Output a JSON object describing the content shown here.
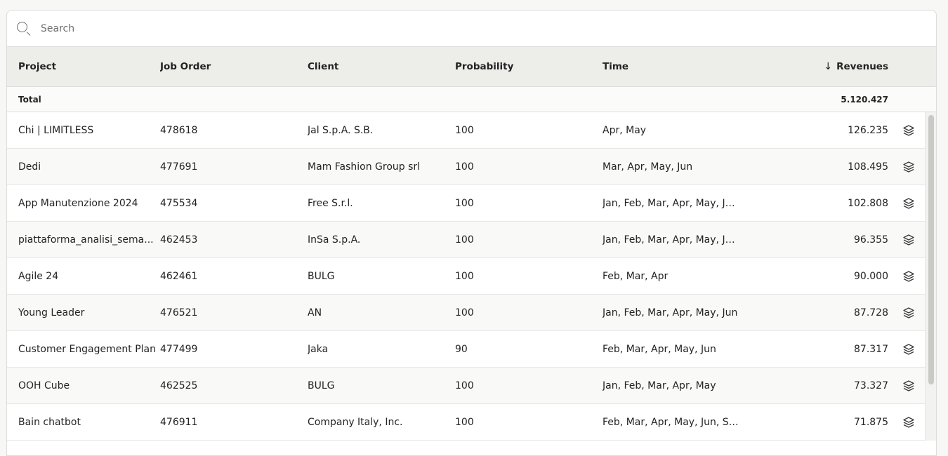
{
  "search": {
    "placeholder": "Search",
    "value": ""
  },
  "columns": {
    "project": "Project",
    "job_order": "Job Order",
    "client": "Client",
    "probability": "Probability",
    "time": "Time",
    "revenues": "Revenues",
    "sort_indicator": "↓"
  },
  "total": {
    "label": "Total",
    "revenues": "5.120.427"
  },
  "rows": [
    {
      "project": "Chi | LIMITLESS",
      "job_order": "478618",
      "client": "Jal S.p.A. S.B.",
      "probability": "100",
      "time": "Apr, May",
      "revenues": "126.235"
    },
    {
      "project": "Dedi",
      "job_order": "477691",
      "client": "Mam Fashion Group srl",
      "probability": "100",
      "time": "Mar, Apr, May, Jun",
      "revenues": "108.495"
    },
    {
      "project": "App Manutenzione 2024",
      "job_order": "475534",
      "client": "Free S.r.l.",
      "probability": "100",
      "time": "Jan, Feb, Mar, Apr, May, Jun,...",
      "revenues": "102.808"
    },
    {
      "project": "piattaforma_analisi_sema...",
      "job_order": "462453",
      "client": "InSa S.p.A.",
      "probability": "100",
      "time": "Jan, Feb, Mar, Apr, May, Jun,...",
      "revenues": "96.355"
    },
    {
      "project": "Agile 24",
      "job_order": "462461",
      "client": "BULG",
      "probability": "100",
      "time": "Feb, Mar, Apr",
      "revenues": "90.000"
    },
    {
      "project": "Young Leader",
      "job_order": "476521",
      "client": "AN",
      "probability": "100",
      "time": "Jan, Feb, Mar, Apr, May, Jun",
      "revenues": "87.728"
    },
    {
      "project": "Customer Engagement Plan",
      "job_order": "477499",
      "client": "Jaka",
      "probability": "90",
      "time": "Feb, Mar, Apr, May, Jun",
      "revenues": "87.317"
    },
    {
      "project": "OOH Cube",
      "job_order": "462525",
      "client": "BULG",
      "probability": "100",
      "time": "Jan, Feb, Mar, Apr, May",
      "revenues": "73.327"
    },
    {
      "project": "Bain chatbot",
      "job_order": "476911",
      "client": "Company Italy, Inc.",
      "probability": "100",
      "time": "Feb, Mar, Apr, May, Jun, Sep",
      "revenues": "71.875"
    }
  ],
  "icons": {
    "search": "search-icon",
    "row_action": "layers-icon",
    "sort": "arrow-down-icon"
  }
}
